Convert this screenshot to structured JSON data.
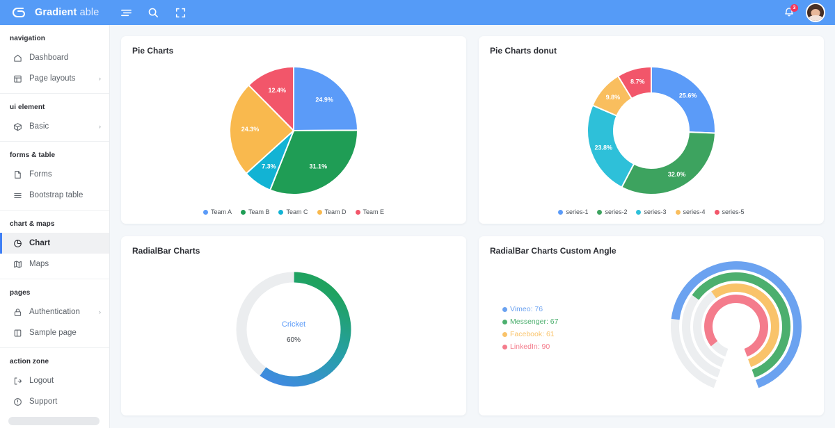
{
  "header": {
    "brand_primary": "Gradient",
    "brand_secondary": "able",
    "logo_icon": "gradient-logo-icon",
    "menu_icon": "hamburger-menu-icon",
    "search_icon": "search-icon",
    "fullscreen_icon": "fullscreen-icon",
    "bell_icon": "notification-bell-icon",
    "notification_count": "3",
    "avatar_name": "user-avatar",
    "bg_color": "#559bf7"
  },
  "sidebar": {
    "sections": [
      {
        "caption": "navigation",
        "items": [
          {
            "label": "Dashboard",
            "icon": "home-icon",
            "active": false,
            "chevron": false
          },
          {
            "label": "Page layouts",
            "icon": "layout-icon",
            "active": false,
            "chevron": true
          }
        ]
      },
      {
        "caption": "ui element",
        "items": [
          {
            "label": "Basic",
            "icon": "box-icon",
            "active": false,
            "chevron": true
          }
        ]
      },
      {
        "caption": "forms & table",
        "items": [
          {
            "label": "Forms",
            "icon": "file-icon",
            "active": false,
            "chevron": false
          },
          {
            "label": "Bootstrap table",
            "icon": "table-icon",
            "active": false,
            "chevron": false
          }
        ]
      },
      {
        "caption": "chart & maps",
        "items": [
          {
            "label": "Chart",
            "icon": "pie-chart-icon",
            "active": true,
            "chevron": false
          },
          {
            "label": "Maps",
            "icon": "map-icon",
            "active": false,
            "chevron": false
          }
        ]
      },
      {
        "caption": "pages",
        "items": [
          {
            "label": "Authentication",
            "icon": "lock-icon",
            "active": false,
            "chevron": true
          },
          {
            "label": "Sample page",
            "icon": "page-icon",
            "active": false,
            "chevron": false
          }
        ]
      },
      {
        "caption": "action zone",
        "items": [
          {
            "label": "Logout",
            "icon": "logout-icon",
            "active": false,
            "chevron": false
          },
          {
            "label": "Support",
            "icon": "help-circle-icon",
            "active": false,
            "chevron": false
          }
        ]
      }
    ],
    "active_accent": "#3f7ff5"
  },
  "cards": {
    "pie": {
      "title": "Pie Charts"
    },
    "donut": {
      "title": "Pie Charts donut"
    },
    "radialbar": {
      "title": "RadialBar Charts"
    },
    "radialbar_custom": {
      "title": "RadialBar Charts Custom Angle"
    }
  },
  "chart_data": [
    {
      "type": "pie",
      "title": "Pie Charts",
      "categories": [
        "Team A",
        "Team B",
        "Team C",
        "Team D",
        "Team E"
      ],
      "values": [
        24.9,
        31.1,
        7.3,
        24.3,
        12.4
      ],
      "labels": [
        "24.9%",
        "31.1%",
        "7.3%",
        "24.3%",
        "12.4%"
      ],
      "colors": [
        "#5b9bf8",
        "#1f9d55",
        "#12b3d4",
        "#f9b94e",
        "#f2566a"
      ],
      "legend_position": "bottom"
    },
    {
      "type": "pie",
      "title": "Pie Charts donut",
      "donut": true,
      "categories": [
        "series-1",
        "series-2",
        "series-3",
        "series-4",
        "series-5"
      ],
      "values": [
        25.6,
        32.0,
        23.8,
        9.8,
        8.7
      ],
      "labels": [
        "25.6%",
        "32.0%",
        "23.8%",
        "9.8%",
        "8.7%"
      ],
      "colors": [
        "#5b9bf8",
        "#3da35f",
        "#2ec0d9",
        "#f9be5e",
        "#f2566a"
      ],
      "legend_position": "bottom"
    },
    {
      "type": "pie",
      "title": "RadialBar Charts",
      "radial": true,
      "categories": [
        "Cricket"
      ],
      "values": [
        60
      ],
      "center_label": "Cricket",
      "center_value": "60%",
      "track_color": "#ebedef",
      "colors": [
        "#1fa25f",
        "#3f8ae0"
      ]
    },
    {
      "type": "bar",
      "title": "RadialBar Charts Custom Angle",
      "radial": true,
      "categories": [
        "Vimeo",
        "Messenger",
        "Facebook",
        "LinkedIn"
      ],
      "values": [
        76,
        67,
        61,
        90
      ],
      "legend_labels": [
        "Vimeo: 76",
        "Messenger: 67",
        "Facebook: 61",
        "LinkedIn: 90"
      ],
      "colors": [
        "#6ba2f0",
        "#4caf6e",
        "#f9c36a",
        "#f47c8c"
      ],
      "track_color": "#eceef0",
      "legend_position": "left"
    }
  ]
}
